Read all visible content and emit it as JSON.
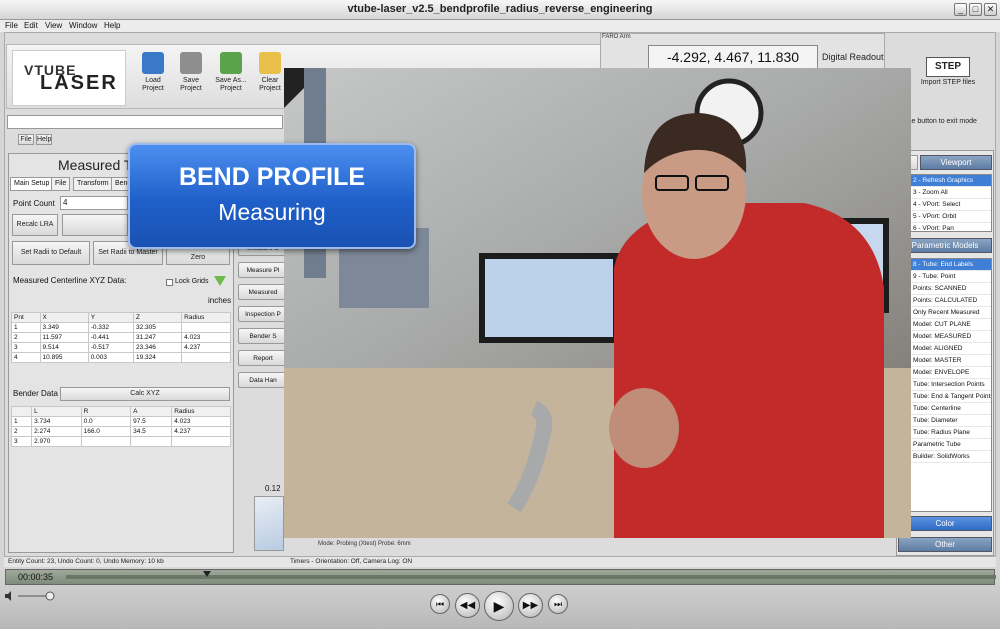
{
  "window": {
    "title": "vtube-laser_v2.5_bendprofile_radius_reverse_engineering",
    "min": "_",
    "max": "□",
    "close": "✕"
  },
  "menu": [
    "File",
    "Edit",
    "View",
    "Window",
    "Help"
  ],
  "app": {
    "logo_top": "VTUBE",
    "logo_bottom": "LASER",
    "toolbar": [
      {
        "label": "Load\nProject",
        "icon": "folder-icon",
        "color": "#3a79c8"
      },
      {
        "label": "Save\nProject",
        "icon": "save-icon",
        "color": "#8e8e8e"
      },
      {
        "label": "Save As...\nProject",
        "icon": "save-as-icon",
        "color": "#5aa34a"
      },
      {
        "label": "Clear\nProject",
        "icon": "clear-icon",
        "color": "#e9c04a"
      }
    ],
    "readout": {
      "mini": "FARO Arm",
      "value": "-4.292, 4.467, 11.830",
      "label": "Digital Readout"
    },
    "step": {
      "logo": "STEP",
      "label": "Import STEP files"
    },
    "exit_hint": "se button to exit mode",
    "subbar": [
      "File",
      "Help"
    ],
    "left": {
      "title": "Measured T",
      "tabs": [
        "Main Setup",
        "File",
        "Transform",
        "Bend"
      ],
      "point_count_label": "Point Count",
      "point_count": "4",
      "recalc": "Recalc LRA",
      "set_radii_default": "Set Radii to Default",
      "set_radii_master": "Set Radii to Master",
      "zero": "Zero",
      "xyz_title": "Measured Centerline XYZ Data:",
      "lock_grids": "Lock Grids",
      "units": "inches",
      "xyz_headers": [
        "Pnt",
        "X",
        "Y",
        "Z",
        "Radius"
      ],
      "xyz_rows": [
        [
          "1",
          "3.349",
          "-0.332",
          "32.305",
          ""
        ],
        [
          "2",
          "11.597",
          "-0.441",
          "31.247",
          "4.023"
        ],
        [
          "3",
          "9.514",
          "-0.517",
          "23.346",
          "4.237"
        ],
        [
          "4",
          "10.895",
          "0.003",
          "19.324",
          ""
        ]
      ],
      "bender_title": "Bender Data",
      "calc_xyz": "Calc XYZ",
      "bender_headers": [
        "",
        "L",
        "R",
        "A",
        "Radius"
      ],
      "bender_rows": [
        [
          "1",
          "3.734",
          "0.0",
          "97.5",
          "4.023"
        ],
        [
          "2",
          "2.274",
          "166.0",
          "34.5",
          "4.237"
        ],
        [
          "3",
          "2.970",
          "",
          "",
          ""
        ]
      ],
      "small_value": "0.12"
    },
    "mid_buttons": [
      "Measure S",
      "Measure Pl",
      "Measured",
      "Inspection P",
      "Bender S",
      "Report",
      "Data Han"
    ],
    "right": {
      "tab_left": "",
      "viewport_header": "Viewport",
      "viewport_items": [
        "2 - Refresh Graphics",
        "3 - Zoom All",
        "4 - VPort: Select",
        "5 - VPort: Orbit",
        "6 - VPort: Pan"
      ],
      "models_header": "Parametric Models",
      "model_items": [
        "8 - Tube: End Labels",
        "9 - Tube: Point",
        "Points: SCANNED",
        "Points: CALCULATED",
        "Only Recent Measured",
        "Model: CUT PLANE",
        "Model: MEASURED",
        "Model: ALIGNED",
        "Model: MASTER",
        "Model: ENVELOPE",
        "Tube: Intersection Points",
        "Tube: End & Tangent Points",
        "Tube: Centerline",
        "Tube: Diameter",
        "Tube: Radius Plane",
        "Parametric Tube",
        "Builder: SolidWorks"
      ],
      "color_btn": "Color",
      "other_btn": "Other"
    },
    "status_left": "Entity Count: 23, Undo Count: 0, Undo Memory: 10 kb",
    "status_right": "Timers - Orientation: Off, Camera Log: ON",
    "tiny_status": "Mode: Probing (Xtest) Probe: 6mm"
  },
  "overlay": {
    "line1": "BEND PROFILE",
    "line2": "Measuring"
  },
  "player": {
    "time": "00:00:35",
    "progress": 0.15
  }
}
